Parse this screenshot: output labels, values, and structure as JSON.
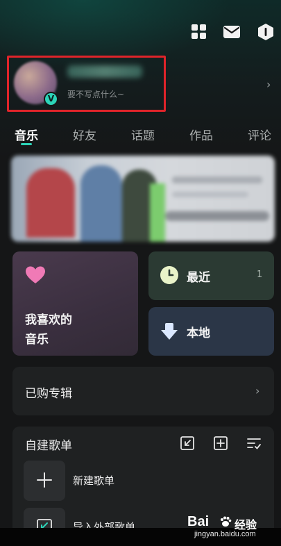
{
  "header": {
    "icons": [
      "grid-icon",
      "mail-icon",
      "shield-icon"
    ]
  },
  "profile": {
    "bio": "要不写点什么~",
    "badge": "V"
  },
  "tabs": [
    {
      "label": "音乐",
      "active": true
    },
    {
      "label": "好友",
      "active": false
    },
    {
      "label": "话题",
      "active": false
    },
    {
      "label": "作品",
      "active": false
    },
    {
      "label": "评论",
      "active": false
    }
  ],
  "cards": {
    "liked_label": "我喜欢的\n音乐",
    "recent_label": "最近",
    "recent_count": "1",
    "local_label": "本地"
  },
  "purchased": {
    "label": "已购专辑"
  },
  "playlists": {
    "title": "自建歌单",
    "new_label": "新建歌单",
    "import_label": "导入外部歌单"
  },
  "watermark": {
    "brand": "Bai",
    "cn": "经验",
    "url": "jingyan.baidu.com"
  },
  "colors": {
    "accent": "#2cd4b8",
    "highlight_box": "#e0242a",
    "background": "#151617"
  }
}
